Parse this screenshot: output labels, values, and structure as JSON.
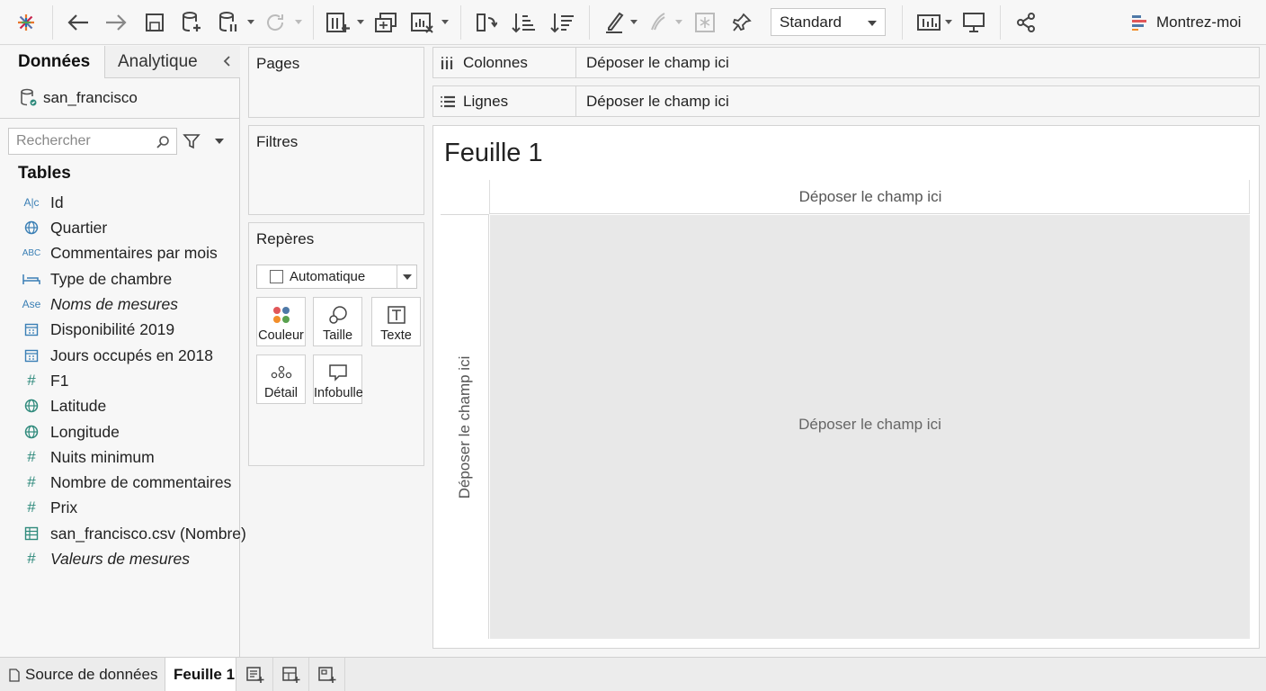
{
  "toolbar": {
    "mark_type_select": "Standard",
    "show_me_label": "Montrez-moi"
  },
  "data_pane": {
    "tabs": {
      "data": "Données",
      "analytics": "Analytique"
    },
    "datasource": "san_francisco",
    "search_placeholder": "Rechercher",
    "tables_heading": "Tables",
    "fields": [
      {
        "icon": "Abc",
        "label": "Id"
      },
      {
        "icon": "globe",
        "label": "Quartier"
      },
      {
        "icon": "Abc",
        "label": "Commentaires par mois"
      },
      {
        "icon": "bed",
        "label": "Type de chambre"
      },
      {
        "icon": "Abc",
        "label": "Noms de mesures"
      },
      {
        "icon": "calendar",
        "label": "Disponibilité 2019"
      },
      {
        "icon": "calendar",
        "label": "Jours occupés en 2018"
      },
      {
        "icon": "#",
        "label": "F1"
      },
      {
        "icon": "globe",
        "label": "Latitude"
      },
      {
        "icon": "globe",
        "label": "Longitude"
      },
      {
        "icon": "#",
        "label": "Nuits minimum"
      },
      {
        "icon": "#",
        "label": "Nombre de commentaires"
      },
      {
        "icon": "#",
        "label": "Prix"
      },
      {
        "icon": "table",
        "label": "san_francisco.csv (Nombre)"
      },
      {
        "icon": "#",
        "label": "Valeurs de mesures"
      }
    ]
  },
  "shelves": {
    "pages": "Pages",
    "filters": "Filtres",
    "marks": "Repères",
    "marks_type": "Automatique",
    "mark_buttons": {
      "color": "Couleur",
      "size": "Taille",
      "text": "Texte",
      "detail": "Détail",
      "tooltip": "Infobulle"
    },
    "columns": "Colonnes",
    "rows": "Lignes",
    "drop_here": "Déposer le champ ici"
  },
  "view": {
    "sheet_title": "Feuille 1",
    "columns_drop": "Déposer le champ ici",
    "rows_drop": "Déposer le champ ici",
    "main_drop": "Déposer le champ ici"
  },
  "bottom_tabs": {
    "datasource": "Source de données",
    "sheet": "Feuille 1"
  }
}
